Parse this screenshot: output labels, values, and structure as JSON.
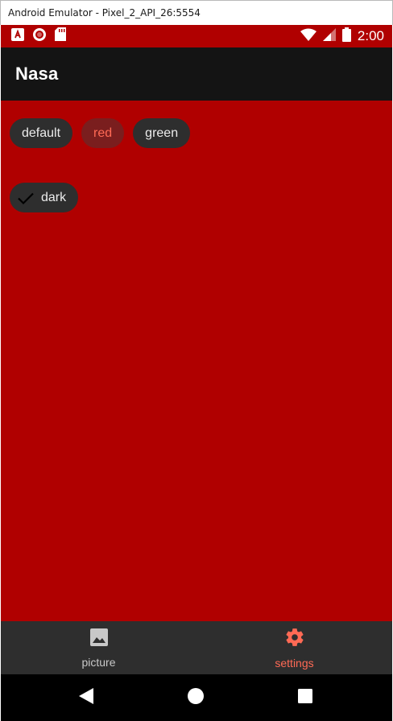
{
  "window": {
    "title": "Android Emulator - Pixel_2_API_26:5554"
  },
  "status_bar": {
    "time": "2:00"
  },
  "app_bar": {
    "title": "Nasa"
  },
  "theme_chips": [
    {
      "label": "default",
      "selected": false
    },
    {
      "label": "red",
      "selected": true
    },
    {
      "label": "green",
      "selected": false
    }
  ],
  "dark_chip": {
    "label": "dark",
    "checked": true
  },
  "bottom_nav": {
    "items": [
      {
        "label": "picture",
        "icon": "image-icon",
        "active": false
      },
      {
        "label": "settings",
        "icon": "gear-icon",
        "active": true
      }
    ]
  },
  "colors": {
    "accent": "#ff6a55",
    "background": "#b00000",
    "chip": "#2e2e2e",
    "app_bar": "#141414"
  }
}
